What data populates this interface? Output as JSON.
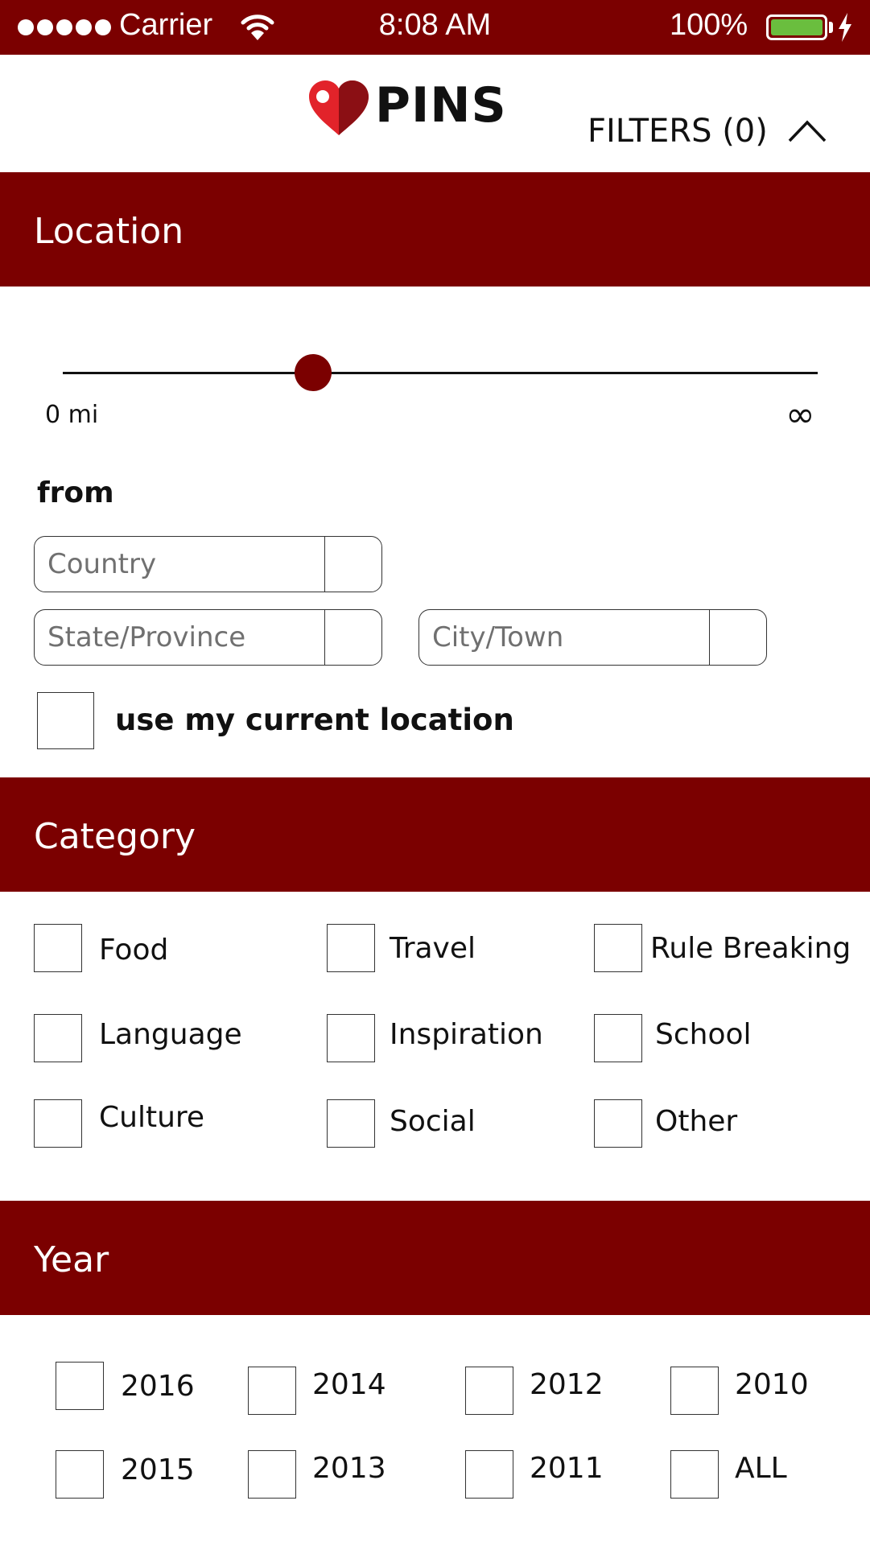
{
  "status_bar": {
    "carrier": "Carrier",
    "time": "8:08 AM",
    "battery": "100%",
    "battery_level": 1.0,
    "battery_color": "#6abe3e"
  },
  "header": {
    "logo_text": "PINS",
    "filters_label": "FILTERS (0)"
  },
  "colors": {
    "accent": "#7b0000",
    "logo_red": "#e2232a"
  },
  "location": {
    "heading": "Location",
    "slider": {
      "min_label": "0 mi",
      "max_label": "∞",
      "value_fraction": 0.33
    },
    "from_label": "from",
    "country_placeholder": "Country",
    "state_placeholder": "State/Province",
    "city_placeholder": "City/Town",
    "use_current_label": "use my current location"
  },
  "category": {
    "heading": "Category",
    "items": [
      "Food",
      "Travel",
      "Rule Breaking",
      "Language",
      "Inspiration",
      "School",
      "Culture",
      "Social",
      "Other"
    ]
  },
  "year": {
    "heading": "Year",
    "items": [
      "2016",
      "2014",
      "2012",
      "2010",
      "2015",
      "2013",
      "2011",
      "ALL"
    ]
  }
}
